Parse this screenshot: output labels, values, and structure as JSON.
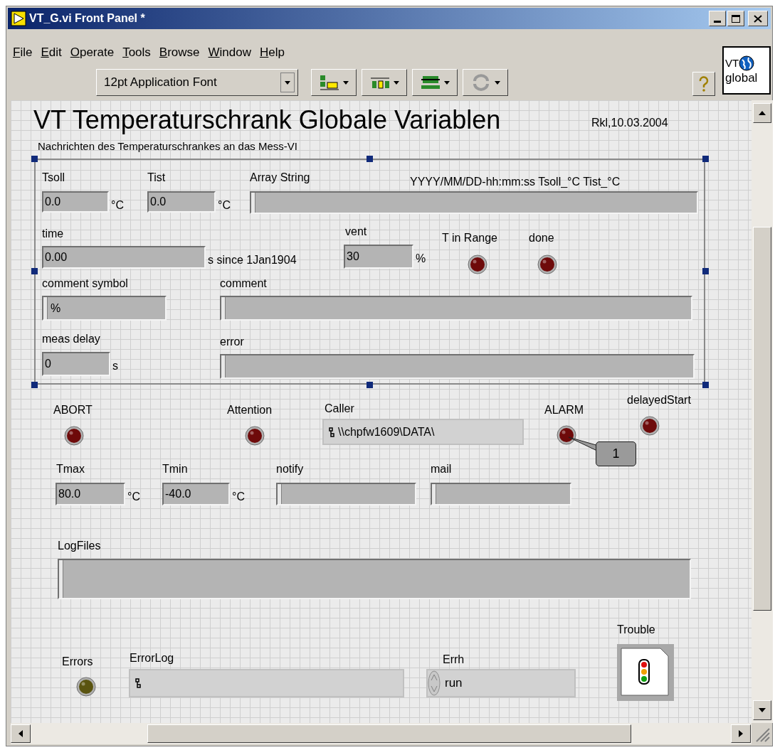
{
  "window": {
    "title": "VT_G.vi Front Panel *"
  },
  "menu": [
    "File",
    "Edit",
    "Operate",
    "Tools",
    "Browse",
    "Window",
    "Help"
  ],
  "toolbar": {
    "font": "12pt Application Font"
  },
  "vi_icon": {
    "line_1": "VT",
    "line_2": "global"
  },
  "panel": {
    "title": "VT Temperaturschrank Globale Variablen",
    "date": "Rkl,10.03.2004",
    "subtitle": "Nachrichten des Temperaturschrankes an das Mess-VI",
    "format_note": "YYYY/MM/DD-hh:mm:ss Tsoll_°C Tist_°C"
  },
  "controls": [
    {
      "kind": "numeric",
      "label": "Tsoll",
      "value": "0.0",
      "unit": "°C"
    },
    {
      "kind": "numeric",
      "label": "Tist",
      "value": "0.0",
      "unit": "°C"
    },
    {
      "kind": "string",
      "label": "Array String"
    },
    {
      "kind": "numeric",
      "label": "time",
      "value": "0.00",
      "unit": "s since 1Jan1904"
    },
    {
      "kind": "numeric",
      "label": "vent",
      "value": "30",
      "unit": "%"
    },
    {
      "kind": "led",
      "label": "T in Range",
      "on": false,
      "color": "#6e0a0a"
    },
    {
      "kind": "led",
      "label": "done",
      "on": false,
      "color": "#6e0a0a"
    },
    {
      "kind": "string",
      "label": "comment symbol",
      "value": "%"
    },
    {
      "kind": "string",
      "label": "comment"
    },
    {
      "kind": "numeric",
      "label": "meas delay",
      "value": "0",
      "unit": "s"
    },
    {
      "kind": "string",
      "label": "error"
    },
    {
      "kind": "led",
      "label": "ABORT",
      "on": false,
      "color": "#6e0a0a"
    },
    {
      "kind": "led",
      "label": "Attention",
      "on": false,
      "color": "#6e0a0a"
    },
    {
      "kind": "path",
      "label": "Caller",
      "value": "\\\\chpfw1609\\DATA\\"
    },
    {
      "kind": "led",
      "label": "ALARM",
      "on": false,
      "color": "#6e0a0a"
    },
    {
      "kind": "led",
      "label": "delayedStart",
      "on": false,
      "color": "#6e0a0a"
    },
    {
      "kind": "numeric",
      "label": "Tmax",
      "value": "80.0",
      "unit": "°C"
    },
    {
      "kind": "numeric",
      "label": "Tmin",
      "value": "-40.0",
      "unit": "°C"
    },
    {
      "kind": "string",
      "label": "notify"
    },
    {
      "kind": "string",
      "label": "mail"
    },
    {
      "kind": "string",
      "label": "LogFiles"
    },
    {
      "kind": "picture_button",
      "label": "Trouble"
    },
    {
      "kind": "led",
      "label": "Errors",
      "on": false,
      "color": "#5a5410"
    },
    {
      "kind": "path",
      "label": "ErrorLog"
    },
    {
      "kind": "ring",
      "label": "Errh",
      "value": "run"
    }
  ],
  "callout": {
    "text": "1"
  }
}
